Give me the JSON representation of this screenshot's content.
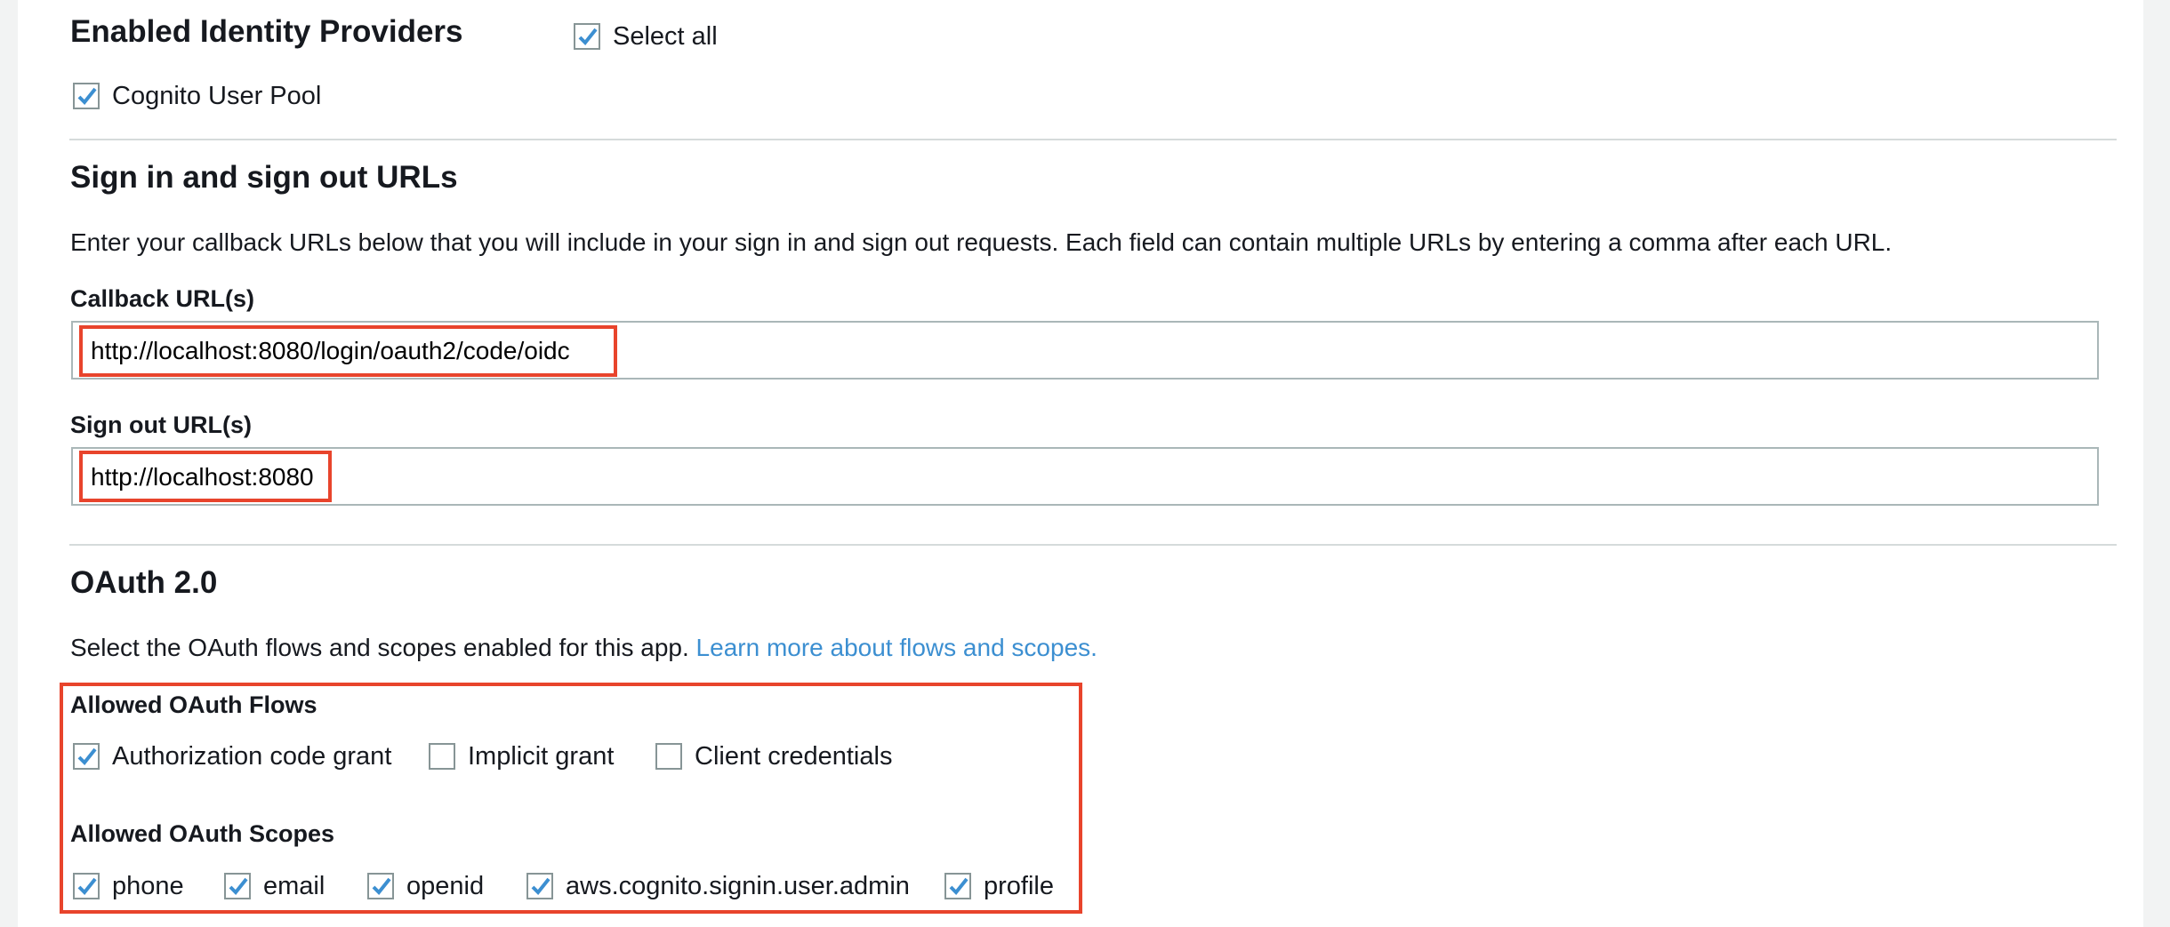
{
  "identity_providers": {
    "heading": "Enabled Identity Providers",
    "select_all_label": "Select all",
    "select_all_checked": true,
    "providers": [
      {
        "label": "Cognito User Pool",
        "checked": true
      }
    ]
  },
  "sign_urls": {
    "heading": "Sign in and sign out URLs",
    "description": "Enter your callback URLs below that you will include in your sign in and sign out requests. Each field can contain multiple URLs by entering a comma after each URL.",
    "callback_label": "Callback URL(s)",
    "callback_value": "http://localhost:8080/login/oauth2/code/oidc",
    "signout_label": "Sign out URL(s)",
    "signout_value": "http://localhost:8080"
  },
  "oauth": {
    "heading": "OAuth 2.0",
    "description": "Select the OAuth flows and scopes enabled for this app.",
    "learn_more_link": "Learn more about flows and scopes.",
    "flows_label": "Allowed OAuth Flows",
    "flows": [
      {
        "label": "Authorization code grant",
        "checked": true
      },
      {
        "label": "Implicit grant",
        "checked": false
      },
      {
        "label": "Client credentials",
        "checked": false
      }
    ],
    "scopes_label": "Allowed OAuth Scopes",
    "scopes": [
      {
        "label": "phone",
        "checked": true
      },
      {
        "label": "email",
        "checked": true
      },
      {
        "label": "openid",
        "checked": true
      },
      {
        "label": "aws.cognito.signin.user.admin",
        "checked": true
      },
      {
        "label": "profile",
        "checked": true
      }
    ]
  },
  "colors": {
    "check": "#3c8fd1",
    "highlight": "#e8442c",
    "link": "#3c8fd1"
  },
  "icons": {
    "checkmark": "checkmark-icon"
  }
}
